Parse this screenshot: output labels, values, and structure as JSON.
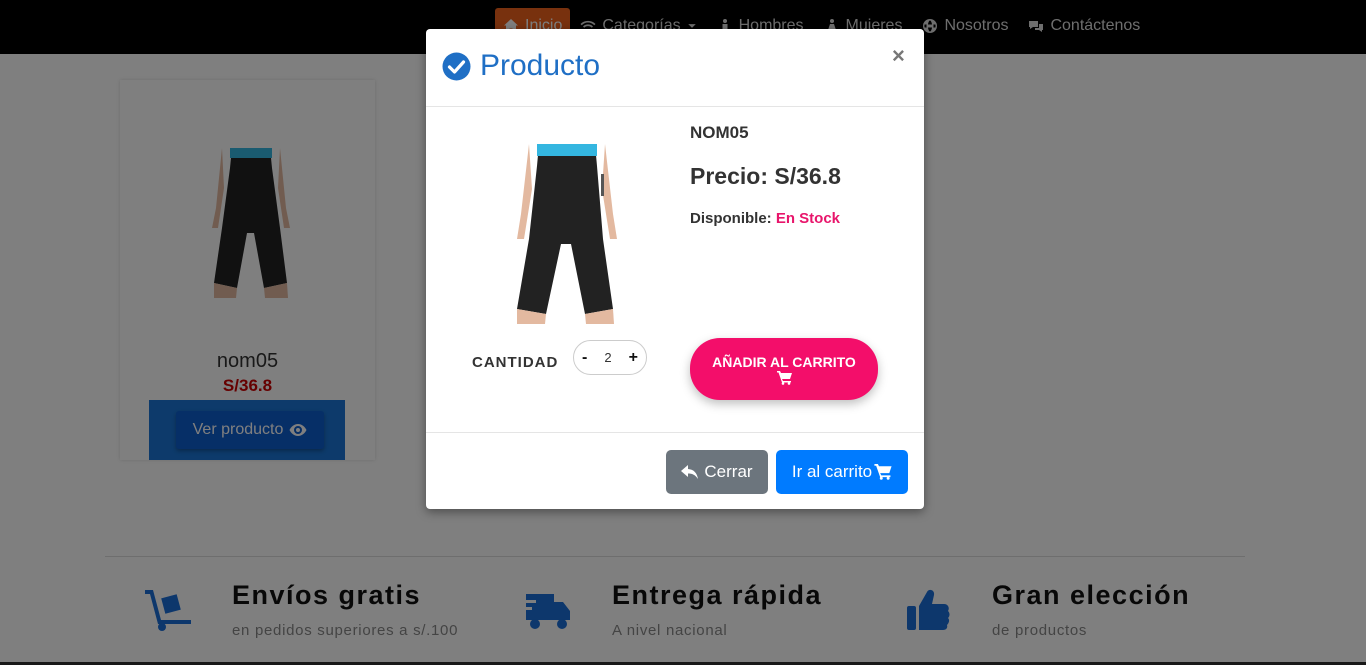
{
  "nav": {
    "items": [
      {
        "label": "Inicio",
        "icon": "home-icon"
      },
      {
        "label": "Categorías",
        "icon": "wifi-icon"
      },
      {
        "label": "Hombres",
        "icon": "male-icon"
      },
      {
        "label": "Mujeres",
        "icon": "female-icon"
      },
      {
        "label": "Nosotros",
        "icon": "globe-icon"
      },
      {
        "label": "Contáctenos",
        "icon": "comments-icon"
      }
    ]
  },
  "card": {
    "name": "nom05",
    "price": "S/36.8",
    "button_label": "Ver producto"
  },
  "features": [
    {
      "title": "Envíos gratis",
      "subtitle": "en pedidos superiores a s/.100",
      "icon": "dolly-icon"
    },
    {
      "title": "Entrega rápida",
      "subtitle": "A nivel nacional",
      "icon": "truck-icon"
    },
    {
      "title": "Gran elección",
      "subtitle": "de productos",
      "icon": "thumbs-up-icon"
    }
  ],
  "modal": {
    "title": "Producto",
    "close_symbol": "×",
    "product_name": "NOM05",
    "price_text": "Precio: S/36.8",
    "availability_label": "Disponible:",
    "availability_value": "En Stock",
    "quantity_label": "CANTIDAD",
    "quantity_minus": "-",
    "quantity_value": "2",
    "quantity_plus": "+",
    "add_to_cart_label": "AÑADIR AL CARRITO",
    "close_button_label": "Cerrar",
    "go_to_cart_label": "Ir al carrito"
  },
  "colors": {
    "nav_active": "#f0631c",
    "accent_blue": "#1f6fc5",
    "pink": "#f30e6a",
    "price_red": "#cc0000"
  }
}
